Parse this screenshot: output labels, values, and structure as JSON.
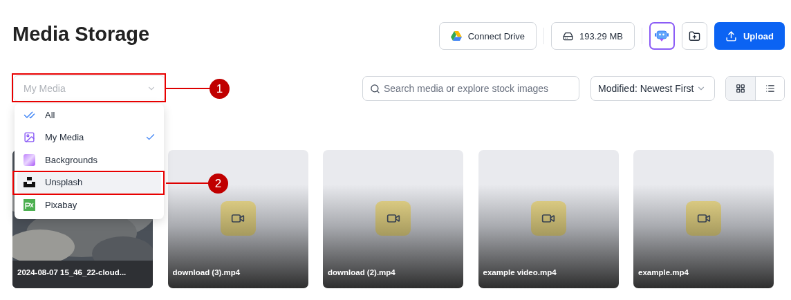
{
  "page": {
    "title": "Media Storage"
  },
  "header_actions": [
    {
      "kind": "drive",
      "label": "Connect Drive"
    },
    {
      "kind": "storage",
      "label": "193.29 MB"
    },
    {
      "kind": "assistant",
      "selected": true
    },
    {
      "kind": "new-folder"
    },
    {
      "kind": "upload",
      "label": "Upload"
    }
  ],
  "source_select": {
    "value": "My Media",
    "expanded": true
  },
  "source_menu": [
    {
      "kind": "all",
      "label": "All",
      "checked": false,
      "highlighted": false
    },
    {
      "kind": "my-media",
      "label": "My Media",
      "checked": true,
      "highlighted": false
    },
    {
      "kind": "backgrounds",
      "label": "Backgrounds",
      "checked": false,
      "highlighted": false
    },
    {
      "kind": "unsplash",
      "label": "Unsplash",
      "checked": false,
      "highlighted": true
    },
    {
      "kind": "pixabay",
      "label": "Pixabay",
      "checked": false,
      "highlighted": false
    }
  ],
  "search": {
    "placeholder": "Search media or explore stock images"
  },
  "sort": {
    "value": "Modified: Newest First"
  },
  "view_toggle": [
    {
      "kind": "grid",
      "selected": true
    },
    {
      "kind": "list",
      "selected": false
    }
  ],
  "media": [
    {
      "kind": "picture",
      "name": "2024-08-07 15_46_22-cloud..."
    },
    {
      "kind": "video",
      "name": "download (3).mp4"
    },
    {
      "kind": "video",
      "name": "download (2).mp4"
    },
    {
      "kind": "video",
      "name": "example video.mp4"
    },
    {
      "kind": "video",
      "name": "example.mp4"
    }
  ],
  "callouts": [
    {
      "label": "1",
      "kind": "select"
    },
    {
      "label": "2",
      "kind": "menu-item"
    }
  ]
}
